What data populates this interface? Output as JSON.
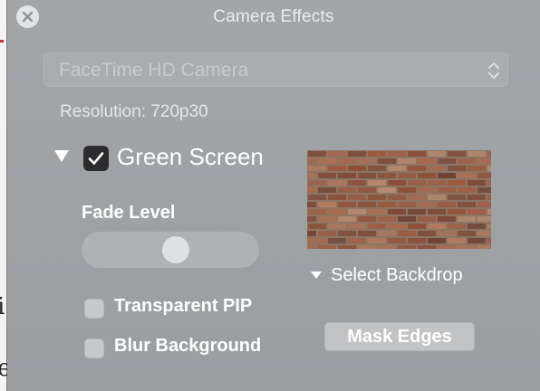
{
  "window": {
    "title": "Camera Effects",
    "close_icon": "close-icon"
  },
  "camera": {
    "selected": "FaceTime HD Camera",
    "resolution": "Resolution: 720p30",
    "stepper_icon": "up-down-chevron-icon"
  },
  "green_screen": {
    "label": "Green Screen",
    "checked": true,
    "expanded": true,
    "fade_label": "Fade Level",
    "fade_level": 0.54,
    "transparent_pip_label": "Transparent PIP",
    "transparent_pip_checked": false,
    "blur_background_label": "Blur Background",
    "blur_background_checked": false
  },
  "backdrop": {
    "image": "brick-wall-backdrop",
    "select_label": "Select Backdrop",
    "mask_edges_label": "Mask Edges"
  },
  "colors": {
    "panel": "#9ea2a5",
    "checkbox_checked": "#2c2c2e",
    "text": "#ffffff"
  }
}
